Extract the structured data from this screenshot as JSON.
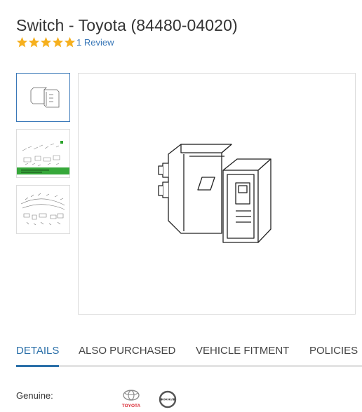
{
  "product": {
    "title": "Switch - Toyota (84480-04020)",
    "rating": 5,
    "review_link": "1 Review"
  },
  "gallery": {
    "thumbnails": [
      {
        "name": "switch-part-thumbnail",
        "selected": true
      },
      {
        "name": "parts-diagram-thumbnail",
        "selected": false
      },
      {
        "name": "dashboard-diagram-thumbnail",
        "selected": false
      }
    ]
  },
  "tabs": [
    {
      "label": "DETAILS",
      "active": true
    },
    {
      "label": "ALSO PURCHASED",
      "active": false
    },
    {
      "label": "VEHICLE FITMENT",
      "active": false
    },
    {
      "label": "POLICIES",
      "active": false
    }
  ],
  "details": {
    "genuine_label": "Genuine:",
    "brands": [
      "TOYOTA",
      "SCION"
    ]
  },
  "colors": {
    "star": "#f6b01e",
    "link": "#3a78b8",
    "active_tab": "#2a6fa8",
    "toyota_red": "#d9232e"
  }
}
